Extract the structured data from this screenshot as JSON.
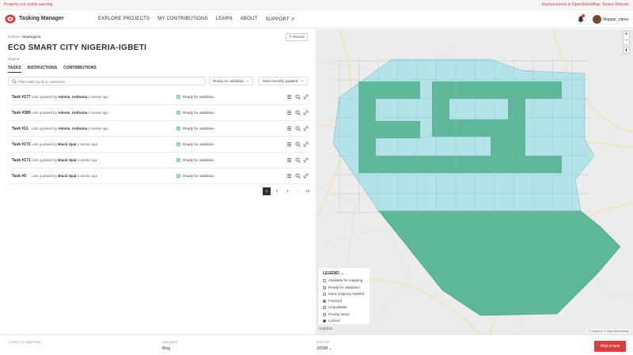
{
  "banner": {
    "left_text": "Property not visible warning",
    "right_text": "Improvements in OpenStreetMap: Tasker Website"
  },
  "header": {
    "brand": "Tasking Manager",
    "nav": [
      "EXPLORE PROJECTS",
      "MY CONTRIBUTIONS",
      "LEARN",
      "ABOUT",
      "SUPPORT ↗"
    ],
    "username": "Mapper_name"
  },
  "project": {
    "breadcrumb_prefix": "#10011 |",
    "breadcrumb_org": "MapNigeria",
    "review_label": "✎ Review",
    "title": "ECO SMART CITY NIGERIA-IGBETI",
    "subtitle": "Nigeria",
    "tabs": [
      "TASKS",
      "INSTRUCTIONS",
      "CONTRIBUTIONS"
    ]
  },
  "filters": {
    "search_placeholder": "Filter tasks by id or username",
    "status_filter": "Ready for validation",
    "sort": "Most recently updated"
  },
  "tasks": [
    {
      "id": "Task #177",
      "prefix": "Last updated by",
      "user": "Adeola_Anthonia",
      "time": "2 weeks ago",
      "status": "Ready for validation"
    },
    {
      "id": "Task #389",
      "prefix": "Last updated by",
      "user": "Adeola_Anthonia",
      "time": "2 weeks ago",
      "status": "Ready for validation"
    },
    {
      "id": "Task #11",
      "prefix": "Last updated by",
      "user": "Adeola_Anthonia",
      "time": "2 weeks ago",
      "status": "Ready for validation"
    },
    {
      "id": "Task #172",
      "prefix": "Last updated by",
      "user": "Black Opal",
      "time": "2 weeks ago",
      "status": "Ready for validation"
    },
    {
      "id": "Task #171",
      "prefix": "Last updated by",
      "user": "Black Opal",
      "time": "2 weeks ago",
      "status": "Ready for validation"
    },
    {
      "id": "Task #5",
      "prefix": "Last updated by",
      "user": "Black Opal",
      "time": "2 weeks ago",
      "status": "Ready for validation"
    }
  ],
  "pagination": [
    "1",
    "2",
    "3",
    "...",
    "10"
  ],
  "legend": {
    "title": "LEGEND ⌄",
    "items": [
      {
        "label": "Available for mapping",
        "color": "#ffffff"
      },
      {
        "label": "Ready for validation",
        "color": "#a7d8d8"
      },
      {
        "label": "More mapping needed",
        "color": "#ffe9a8"
      },
      {
        "label": "Finished",
        "color": "#3aa885"
      },
      {
        "label": "Unavailable",
        "color": "#cccccc"
      },
      {
        "label": "Priority areas",
        "color": "#f3c7c7"
      },
      {
        "label": "Locked",
        "color": "#2c3038"
      }
    ]
  },
  "map": {
    "mapbox_label": "mapbox",
    "attribution": "© Mapbox © OpenStreetMap",
    "zoom_in": "+",
    "zoom_out": "−",
    "compass": "⬆"
  },
  "footer": {
    "types_label": "TYPES OF MAPPING",
    "imagery_label": "IMAGERY",
    "imagery_value": "Bing",
    "editor_label": "EDITOR",
    "editor_value": "JOSM ⌄",
    "action": "Map a task"
  },
  "colors": {
    "accent": "#d73f3f",
    "validation": "#a7d8d8",
    "finished": "#3aa885"
  }
}
